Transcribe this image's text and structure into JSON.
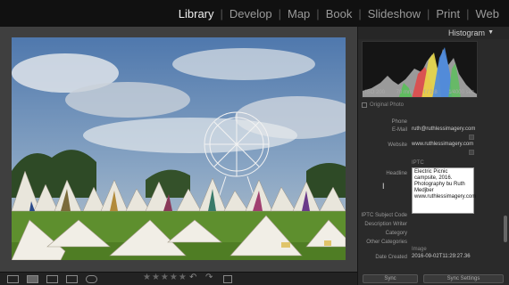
{
  "modules": [
    {
      "label": "Library",
      "active": true
    },
    {
      "label": "Develop",
      "active": false
    },
    {
      "label": "Map",
      "active": false
    },
    {
      "label": "Book",
      "active": false
    },
    {
      "label": "Slideshow",
      "active": false
    },
    {
      "label": "Print",
      "active": false
    },
    {
      "label": "Web",
      "active": false
    }
  ],
  "separator": "|",
  "histogram": {
    "title": "Histogram",
    "iso": "ISO 200",
    "focal": "70 mm",
    "aperture": "f / 2.8",
    "shutter": "1⁄4000 sec",
    "original_photo": "Original Photo"
  },
  "metadata": {
    "phone": {
      "label": "Phone",
      "value": ""
    },
    "email": {
      "label": "E-Mail",
      "value": "ruth@ruthlessimagery.com"
    },
    "website": {
      "label": "Website",
      "value": "www.ruthlessimagery.com"
    },
    "iptc": {
      "label": "",
      "value": "IPTC"
    },
    "headline": {
      "label": "Headline",
      "value": "Electric Picnic campsite, 2016. Photography bu Ruth Medjber www.ruthlessimagery.com"
    },
    "iptc_subject": {
      "label": "IPTC Subject Code",
      "value": ""
    },
    "description_writer": {
      "label": "Description Writer",
      "value": ""
    },
    "category": {
      "label": "Category",
      "value": ""
    },
    "other_categories": {
      "label": "Other Categories",
      "value": ""
    },
    "image": {
      "label": "",
      "value": "Image"
    },
    "date_created": {
      "label": "Date Created",
      "value": "2016-09-02T11:29:27.36"
    }
  },
  "bottom": {
    "stars": "★★★★★",
    "sync": "Sync",
    "sync_settings": "Sync Settings"
  },
  "colors": {
    "accent": "#eeeeee",
    "panel_bg": "#2a2a2a",
    "sky": "#5f86b8"
  }
}
